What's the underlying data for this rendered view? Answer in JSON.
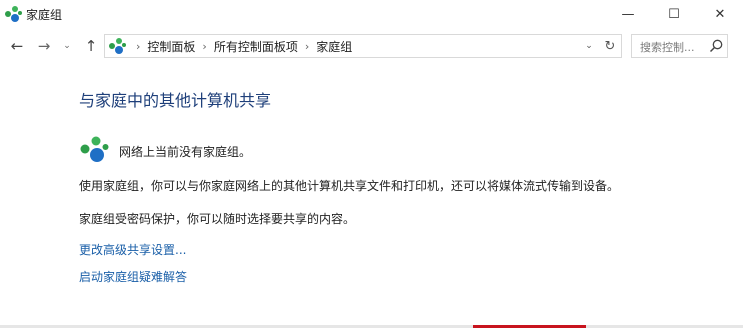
{
  "window": {
    "title": "家庭组",
    "app_icon": "homegroup-icon",
    "minimize_glyph": "—",
    "maximize_glyph": "☐",
    "close_glyph": "✕"
  },
  "nav": {
    "back_glyph": "←",
    "forward_glyph": "→",
    "recent_glyph": "⌄",
    "up_glyph": "↑",
    "address_icon": "homegroup-icon",
    "breadcrumbs": [
      "控制面板",
      "所有控制面板项",
      "家庭组"
    ],
    "breadcrumb_separator": "›",
    "dropdown_glyph": "⌄",
    "refresh_glyph": "↻",
    "search_placeholder": "搜索控制...",
    "search_icon": "search-icon"
  },
  "main": {
    "title": "与家庭中的其他计算机共享",
    "status": "网络上当前没有家庭组。",
    "paragraph1": "使用家庭组，你可以与你家庭网络上的其他计算机共享文件和打印机，还可以将媒体流式传输到设备。",
    "paragraph2": "家庭组受密码保护，你可以随时选择要共享的内容。",
    "link_advanced": "更改高级共享设置...",
    "link_troubleshoot": "启动家庭组疑难解答"
  },
  "colors": {
    "title": "#1e3f7a",
    "link": "#1a5fa8",
    "homegroup_green": "#2e9e4a",
    "homegroup_blue": "#1f6fc5",
    "bottom_accent": "#c8141e"
  }
}
